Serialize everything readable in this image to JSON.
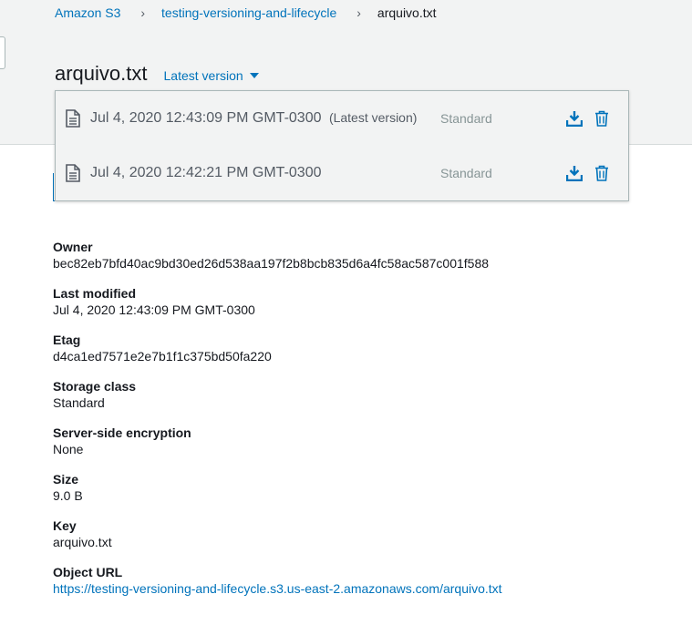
{
  "breadcrumb": {
    "root": "Amazon S3",
    "bucket": "testing-versioning-and-lifecycle",
    "current": "arquivo.txt"
  },
  "title": "arquivo.txt",
  "version_toggle": "Latest version",
  "versions": [
    {
      "date": "Jul 4, 2020 12:43:09 PM GMT-0300",
      "tag": "(Latest version)",
      "storage_class": "Standard"
    },
    {
      "date": "Jul 4, 2020 12:42:21 PM GMT-0300",
      "tag": "",
      "storage_class": "Standard"
    }
  ],
  "icons": {
    "file": "file-icon",
    "download": "download-icon",
    "delete": "trash-icon"
  },
  "colors": {
    "link": "#0073bb",
    "header_bg": "#f2f3f3"
  },
  "details": {
    "owner_label": "Owner",
    "owner": "bec82eb7bfd40ac9bd30ed26d538aa197f2b8bcb835d6a4fc58ac587c001f588",
    "last_modified_label": "Last modified",
    "last_modified": "Jul 4, 2020 12:43:09 PM GMT-0300",
    "etag_label": "Etag",
    "etag": "d4ca1ed7571e2e7b1f1c375bd50fa220",
    "storage_class_label": "Storage class",
    "storage_class": "Standard",
    "encryption_label": "Server-side encryption",
    "encryption": "None",
    "size_label": "Size",
    "size": "9.0 B",
    "key_label": "Key",
    "key": "arquivo.txt",
    "url_label": "Object URL",
    "url": "https://testing-versioning-and-lifecycle.s3.us-east-2.amazonaws.com/arquivo.txt"
  }
}
